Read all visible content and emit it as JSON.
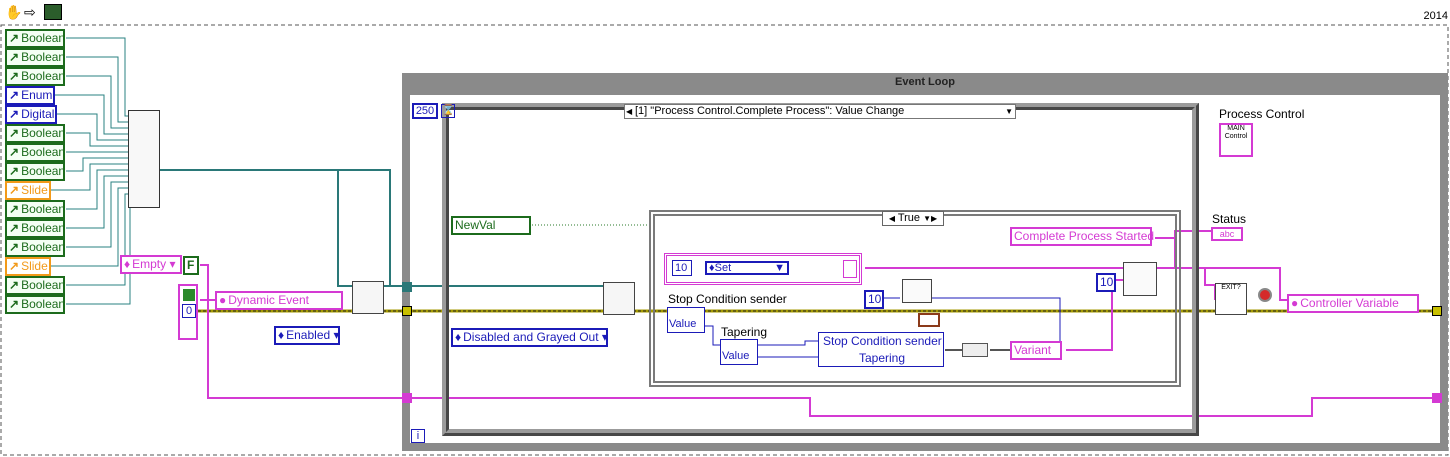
{
  "toolbar": {
    "icons": [
      "hand-icon",
      "arrow-icon",
      "labview-icon"
    ]
  },
  "version_label": "2014",
  "controls": {
    "bool_label": "Boolean",
    "enum_label": "Enum",
    "digital_label": "Digital",
    "slide_label": "Slide"
  },
  "left_column": [
    "Boolean",
    "Boolean",
    "Boolean",
    "Enum",
    "Digital",
    "Boolean",
    "Boolean",
    "Boolean",
    "Slide",
    "Boolean",
    "Boolean",
    "Boolean",
    "Slide",
    "Boolean",
    "Boolean"
  ],
  "event_reg": {
    "empty_label": "Empty",
    "false_const": "F",
    "zero_const": "0",
    "dynamic_event": "Dynamic Event",
    "enabled": "Enabled"
  },
  "event_loop": {
    "title": "Event Loop",
    "timeout": "250",
    "event_case": "[1] \"Process Control.Complete Process\": Value Change",
    "newval": "NewVal",
    "disabled_grayed": "Disabled and Grayed Out",
    "iteration": "i"
  },
  "case_structure": {
    "selector": "True",
    "set_const_num": "10",
    "set_label": "Set",
    "stop_sender": "Stop Condition sender",
    "value": "Value",
    "tapering": "Tapering",
    "bundle_top": "Stop Condition sender",
    "bundle_bottom": "Tapering",
    "variant": "Variant",
    "const_10a": "10",
    "const_10b": "10",
    "complete_started": "Complete Process Started"
  },
  "right_side": {
    "process_control": "Process Control",
    "main_control": "MAIN Control",
    "status": "Status",
    "status_type": "abc",
    "exit": "EXIT?",
    "controller_variable": "Controller Variable"
  }
}
